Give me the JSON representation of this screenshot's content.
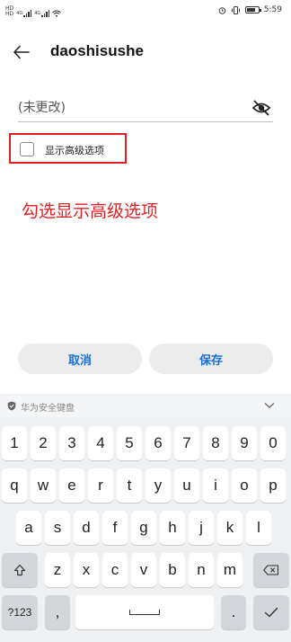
{
  "status_bar": {
    "left_hd_top": "HD",
    "left_hd_bottom": "HD",
    "signal1": "4G",
    "signal2": "4G",
    "time": "5:59"
  },
  "header": {
    "title": "daoshisushe"
  },
  "password": {
    "placeholder": "(未更改)"
  },
  "advanced": {
    "label": "显示高级选项",
    "checked": false
  },
  "annotation": "勾选显示高级选项",
  "actions": {
    "cancel": "取消",
    "save": "保存"
  },
  "colors": {
    "accent": "#1a6fd8",
    "annotation": "#e02020"
  },
  "keyboard": {
    "title": "华为安全键盘",
    "row1": [
      "1",
      "2",
      "3",
      "4",
      "5",
      "6",
      "7",
      "8",
      "9",
      "0"
    ],
    "row2": [
      "q",
      "w",
      "e",
      "r",
      "t",
      "y",
      "u",
      "i",
      "o",
      "p"
    ],
    "row3": [
      "a",
      "s",
      "d",
      "f",
      "g",
      "h",
      "j",
      "k",
      "l"
    ],
    "row4": [
      "z",
      "x",
      "c",
      "v",
      "b",
      "n",
      "m"
    ],
    "symbols": "?123",
    "comma": ",",
    "period": "."
  }
}
